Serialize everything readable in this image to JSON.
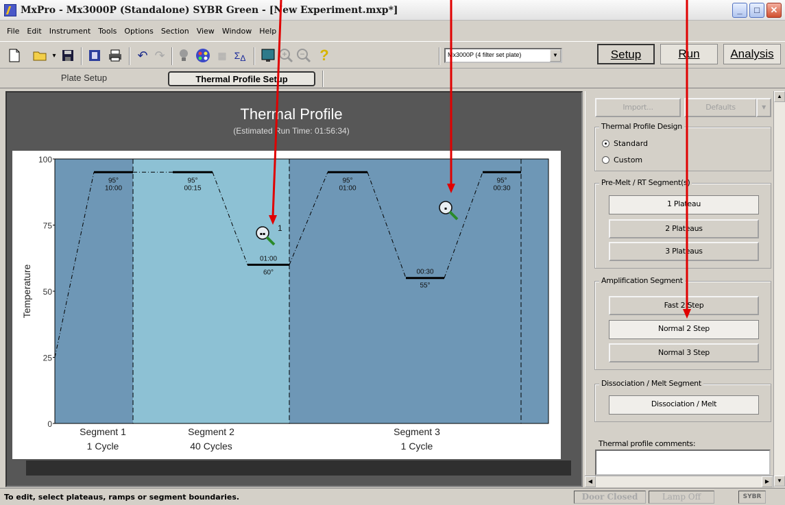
{
  "window": {
    "title": "MxPro - Mx3000P (Standalone) SYBR Green - [New Experiment.mxp*]",
    "minimize": "_",
    "maximize": "□",
    "close": "✕"
  },
  "menu": [
    "File",
    "Edit",
    "Instrument",
    "Tools",
    "Options",
    "Section",
    "View",
    "Window",
    "Help"
  ],
  "toolbar": {
    "plate_select": "Mx3000P (4 filter set plate)",
    "modes": [
      "Setup",
      "Run",
      "Analysis"
    ],
    "active_mode": "Setup",
    "icons": [
      "new-file-icon",
      "open-folder-icon",
      "save-icon",
      "plate-icon",
      "print-icon",
      "undo-icon",
      "redo-icon",
      "bulb-icon",
      "dye-icon",
      "calendar-icon",
      "sigma-delta-icon",
      "monitor-icon",
      "zoom-in-icon",
      "zoom-out-icon",
      "help-icon"
    ]
  },
  "tabs": {
    "plate": "Plate Setup",
    "thermal": "Thermal Profile Setup"
  },
  "chart": {
    "title": "Thermal Profile",
    "subtitle": "(Estimated Run Time: 01:56:34)",
    "ylabel": "Temperature",
    "yticks": [
      "100",
      "75",
      "50",
      "25",
      "0"
    ],
    "plateau_labels": [
      {
        "temp": "95°",
        "time": "10:00"
      },
      {
        "temp": "95°",
        "time": "00:15"
      },
      {
        "temp": "60°",
        "time": "01:00"
      },
      {
        "temp": "95°",
        "time": "01:00"
      },
      {
        "temp": "55°",
        "time": "00:30"
      },
      {
        "temp": "95°",
        "time": "00:30"
      }
    ],
    "collect_marker": "1",
    "segments": [
      {
        "name": "Segment 1",
        "cycles": "1 Cycle"
      },
      {
        "name": "Segment 2",
        "cycles": "40 Cycles"
      },
      {
        "name": "Segment 3",
        "cycles": "1 Cycle"
      }
    ],
    "colors": {
      "dark": "#6e97b6",
      "light": "#8dc1d4",
      "plot_bg": "#ffffff",
      "line": "#000000"
    }
  },
  "chart_data": {
    "type": "line",
    "title": "Thermal Profile",
    "ylabel": "Temperature",
    "ylim": [
      0,
      100
    ],
    "segments": [
      {
        "name": "Segment 1",
        "cycles": 1,
        "steps": [
          {
            "temperature": 95,
            "hold": "10:00"
          }
        ]
      },
      {
        "name": "Segment 2",
        "cycles": 40,
        "steps": [
          {
            "temperature": 95,
            "hold": "00:15"
          },
          {
            "temperature": 60,
            "hold": "01:00",
            "data_collection": true
          }
        ]
      },
      {
        "name": "Segment 3",
        "cycles": 1,
        "steps": [
          {
            "temperature": 95,
            "hold": "01:00"
          },
          {
            "temperature": 55,
            "hold": "00:30"
          },
          {
            "temperature": 95,
            "hold": "00:30"
          }
        ]
      }
    ]
  },
  "right_panel": {
    "import": "Import...",
    "defaults": "Defaults",
    "design_group": "Thermal Profile Design",
    "standard": "Standard",
    "custom": "Custom",
    "premelt_group": "Pre-Melt / RT Segment(s)",
    "premelt_buttons": [
      "1 Plateau",
      "2 Plateaus",
      "3 Plateaus"
    ],
    "amp_group": "Amplification Segment",
    "amp_buttons": [
      "Fast 2 Step",
      "Normal 2 Step",
      "Normal 3 Step"
    ],
    "diss_group": "Dissociation / Melt Segment",
    "diss_button": "Dissociation / Melt",
    "comments_label": "Thermal profile comments:"
  },
  "status": {
    "text": "To edit, select plateaus, ramps or segment boundaries.",
    "door": "Door Closed",
    "lamp": "Lamp Off",
    "mode": "SYBR"
  },
  "annotation_color": "#e00000"
}
